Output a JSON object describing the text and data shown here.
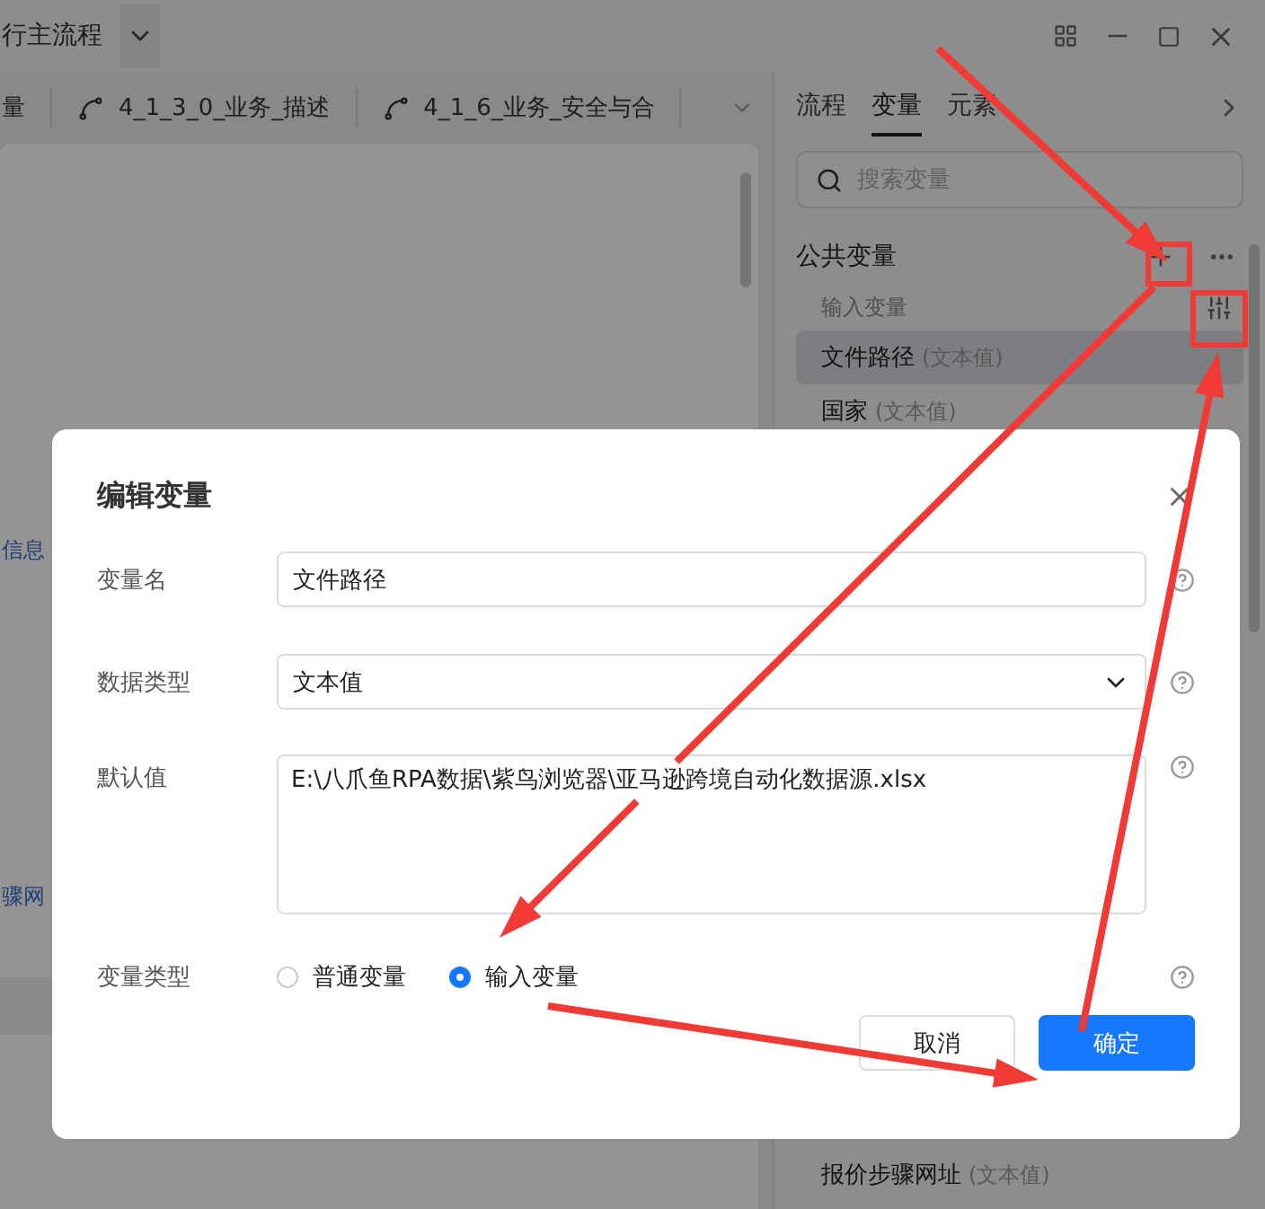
{
  "top_bar": {
    "flow_name": "行主流程"
  },
  "flow_tabs": [
    {
      "kind": "partial",
      "label": "量"
    },
    {
      "kind": "flow",
      "label": "4_1_3_0_业务_描述"
    },
    {
      "kind": "flow",
      "label": "4_1_6_业务_安全与合"
    }
  ],
  "canvas_texts": [
    "信息",
    "骤网"
  ],
  "side_panel": {
    "tabs": [
      {
        "label": "流程",
        "selected": false
      },
      {
        "label": "变量",
        "selected": true
      },
      {
        "label": "元素",
        "selected": false
      }
    ],
    "search": {
      "placeholder": "搜索变量"
    },
    "section_title": "公共变量",
    "group_title": "输入变量",
    "variables": [
      {
        "name": "文件路径",
        "type": "(文本值)",
        "selected": true
      },
      {
        "name": "国家",
        "type": "(文本值)",
        "selected": false
      }
    ],
    "lower_variables": [
      {
        "name": "报价步骤网址",
        "type": "(文本值)",
        "selected": false
      }
    ]
  },
  "dialog": {
    "title": "编辑变量",
    "fields": [
      {
        "kind": "input",
        "label": "变量名",
        "value": "文件路径"
      },
      {
        "kind": "select",
        "label": "数据类型",
        "value": "文本值"
      },
      {
        "kind": "textarea",
        "label": "默认值",
        "value": "E:\\八爪鱼RPA数据\\紫鸟浏览器\\亚马逊跨境自动化数据源.xlsx"
      },
      {
        "kind": "radio",
        "label": "变量类型",
        "options": [
          {
            "label": "普通变量",
            "selected": false
          },
          {
            "label": "输入变量",
            "selected": true
          }
        ]
      }
    ],
    "buttons": [
      {
        "label": "取消",
        "primary": false
      },
      {
        "label": "确定",
        "primary": true
      }
    ]
  }
}
